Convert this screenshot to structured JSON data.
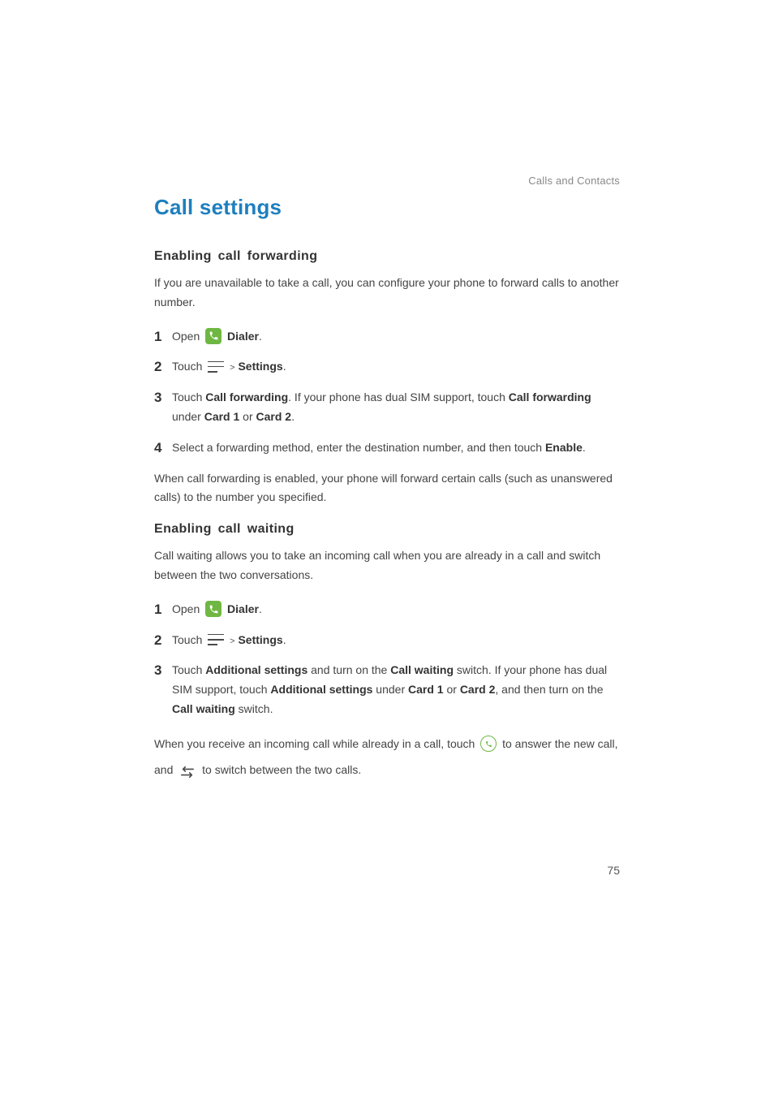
{
  "header": {
    "crumb": "Calls and Contacts"
  },
  "title": "Call settings",
  "section1": {
    "heading": "Enabling  call  forwarding",
    "intro": "If you are unavailable to take a call, you can configure your phone to forward calls to another number.",
    "step1_open": "Open",
    "dialer": "Dialer",
    "period": ".",
    "step2_touch": "Touch",
    "gt": ">",
    "settings": "Settings",
    "step3_a": "Touch ",
    "step3_b": "Call forwarding",
    "step3_c": ". If your phone has dual SIM support, touch ",
    "step3_d": "Call forwarding",
    "step3_e": " under ",
    "step3_f": "Card 1",
    "step3_g": " or ",
    "step3_h": "Card 2",
    "step3_i": ".",
    "step4_a": "Select a forwarding method, enter the destination number, and then touch ",
    "step4_b": "Enable",
    "step4_c": ".",
    "outro": "When call forwarding is enabled, your phone will forward certain calls (such as unanswered calls) to the number you specified."
  },
  "section2": {
    "heading": "Enabling  call  waiting",
    "intro": "Call waiting allows you to take an incoming call when you are already in a call and switch between the two conversations.",
    "step1_open": "Open",
    "dialer": "Dialer",
    "period": ".",
    "step2_touch": "Touch",
    "gt": ">",
    "settings": "Settings",
    "step3_a": "Touch ",
    "step3_b": "Additional settings",
    "step3_c": " and turn on the ",
    "step3_d": "Call waiting",
    "step3_e": " switch. If your phone has dual SIM support, touch ",
    "step3_f": "Additional settings",
    "step3_g": " under ",
    "step3_h": "Card 1",
    "step3_i": " or ",
    "step3_j": "Card 2",
    "step3_k": ", and then turn on the ",
    "step3_l": "Call waiting",
    "step3_m": " switch.",
    "outro_a": "When you receive an incoming call while already in a call, touch ",
    "outro_b": " to answer the new call, and ",
    "outro_c": " to switch between the two calls."
  },
  "nums": {
    "n1": "1",
    "n2": "2",
    "n3": "3",
    "n4": "4"
  },
  "page_number": "75"
}
